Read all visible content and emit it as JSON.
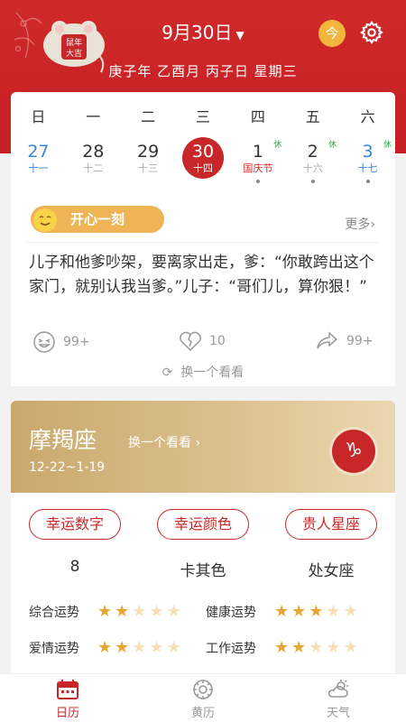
{
  "header": {
    "seal_text": "鼠年大吉",
    "date_title": "9月30日",
    "today_label": "今",
    "ganzhi": "庚子年 乙酉月 丙子日 星期三",
    "colors": {
      "primary": "#c8272a",
      "today": "#f3b53c"
    }
  },
  "calendar": {
    "weekdays": [
      "日",
      "一",
      "二",
      "三",
      "四",
      "五",
      "六"
    ],
    "days": [
      {
        "num": "27",
        "lunar": "十一",
        "style": "blue",
        "rest": "",
        "dot": false
      },
      {
        "num": "28",
        "lunar": "十二",
        "style": "normal",
        "rest": "",
        "dot": false
      },
      {
        "num": "29",
        "lunar": "十三",
        "style": "normal",
        "rest": "",
        "dot": false
      },
      {
        "num": "30",
        "lunar": "十四",
        "style": "selected",
        "rest": "",
        "dot": false
      },
      {
        "num": "1",
        "lunar": "国庆节",
        "style": "holiday",
        "rest": "休",
        "dot": true
      },
      {
        "num": "2",
        "lunar": "十六",
        "style": "normal",
        "rest": "休",
        "dot": true
      },
      {
        "num": "3",
        "lunar": "十七",
        "style": "blue",
        "rest": "休",
        "dot": true
      }
    ]
  },
  "joke": {
    "tag": "开心一刻",
    "more": "更多",
    "text": "儿子和他爹吵架，要离家出走，爹：“你敢跨出这个家门，就别认我当爹。”儿子：“哥们儿，算你狠！”",
    "laugh_count": "99+",
    "dislike_count": "10",
    "share_count": "99+",
    "refresh": "换一个看看"
  },
  "zodiac": {
    "name": "摩羯座",
    "switch": "换一个看看",
    "range": "12-22~1-19",
    "symbol": "♑",
    "pills": [
      "幸运数字",
      "幸运颜色",
      "贵人星座"
    ],
    "values": [
      "8",
      "卡其色",
      "处女座"
    ],
    "fortunes": [
      {
        "label": "综合运势",
        "stars": 2
      },
      {
        "label": "健康运势",
        "stars": 3
      },
      {
        "label": "爱情运势",
        "stars": 2
      },
      {
        "label": "工作运势",
        "stars": 2
      }
    ]
  },
  "tabbar": {
    "tabs": [
      {
        "label": "日历",
        "icon": "calendar-icon",
        "active": true
      },
      {
        "label": "黄历",
        "icon": "almanac-icon",
        "active": false
      },
      {
        "label": "天气",
        "icon": "weather-icon",
        "active": false
      }
    ]
  }
}
